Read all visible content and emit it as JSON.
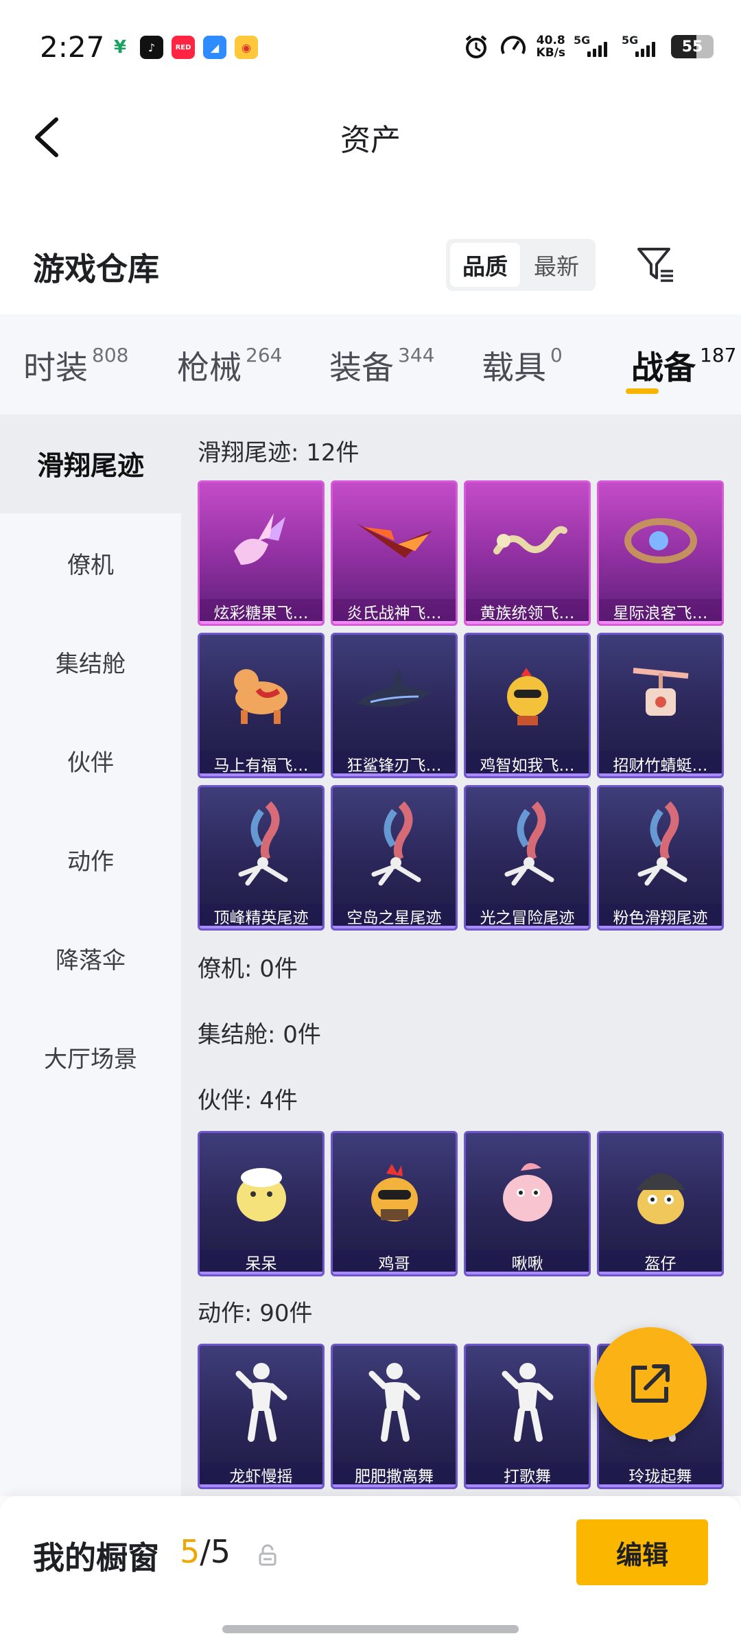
{
  "status": {
    "time": "2:27",
    "speed_value": "40.8",
    "speed_unit": "KB/s",
    "signal1": "5G",
    "signal2": "5G",
    "battery": "55"
  },
  "header": {
    "title": "资产"
  },
  "warehouse": {
    "title": "游戏仓库",
    "sort_options": [
      "品质",
      "最新"
    ],
    "active_sort": "品质"
  },
  "tabs": [
    {
      "label": "时装",
      "count": "808"
    },
    {
      "label": "枪械",
      "count": "264"
    },
    {
      "label": "装备",
      "count": "344"
    },
    {
      "label": "载具",
      "count": "0"
    },
    {
      "label": "战备",
      "count": "187"
    }
  ],
  "active_tab": "战备",
  "sidebar": {
    "items": [
      "滑翔尾迹",
      "僚机",
      "集结舱",
      "伙伴",
      "动作",
      "降落伞",
      "大厅场景"
    ],
    "active": "滑翔尾迹"
  },
  "groups": {
    "glide": {
      "title": "滑翔尾迹: 12件",
      "items": [
        {
          "name": "炫彩糖果飞…",
          "rarity": "epic",
          "art": "candy-wing-icon"
        },
        {
          "name": "炎氏战神飞…",
          "rarity": "epic",
          "art": "flame-wing-icon"
        },
        {
          "name": "黄族统领飞…",
          "rarity": "epic",
          "art": "dragon-icon"
        },
        {
          "name": "星际浪客飞…",
          "rarity": "epic",
          "art": "star-ring-icon"
        },
        {
          "name": "马上有福飞…",
          "rarity": "rare",
          "art": "horse-icon"
        },
        {
          "name": "狂鲨锋刃飞…",
          "rarity": "rare",
          "art": "shark-icon"
        },
        {
          "name": "鸡智如我飞…",
          "rarity": "rare",
          "art": "chicken-icon"
        },
        {
          "name": "招财竹蜻蜓…",
          "rarity": "rare",
          "art": "bamboo-copter-icon"
        },
        {
          "name": "顶峰精英尾迹",
          "rarity": "rare",
          "art": "smoke-trail-icon"
        },
        {
          "name": "空岛之星尾迹",
          "rarity": "rare",
          "art": "smoke-trail-icon"
        },
        {
          "name": "光之冒险尾迹",
          "rarity": "rare",
          "art": "smoke-trail-icon"
        },
        {
          "name": "粉色滑翔尾迹",
          "rarity": "rare",
          "art": "smoke-trail-icon"
        }
      ]
    },
    "drone": {
      "title": "僚机: 0件"
    },
    "pod": {
      "title": "集结舱: 0件"
    },
    "partner": {
      "title": "伙伴: 4件",
      "items": [
        {
          "name": "呆呆",
          "rarity": "rare",
          "art": "chick-icon"
        },
        {
          "name": "鸡哥",
          "rarity": "rare",
          "art": "rooster-icon"
        },
        {
          "name": "啾啾",
          "rarity": "rare",
          "art": "pink-bird-icon"
        },
        {
          "name": "盔仔",
          "rarity": "rare",
          "art": "helmet-chick-icon"
        }
      ]
    },
    "emote": {
      "title": "动作: 90件",
      "items": [
        {
          "name": "龙虾慢摇",
          "rarity": "rare",
          "art": "dance-icon"
        },
        {
          "name": "肥肥撒离舞",
          "rarity": "rare",
          "art": "dance-icon"
        },
        {
          "name": "打歌舞",
          "rarity": "rare",
          "art": "dance-icon"
        },
        {
          "name": "玲珑起舞",
          "rarity": "rare",
          "art": "dance-icon"
        }
      ]
    }
  },
  "bottom": {
    "label": "我的橱窗",
    "current": "5",
    "total": "/5",
    "edit_label": "编辑"
  },
  "colors": {
    "accent": "#fbb700",
    "epic_card": "#c44cc9",
    "rare_card": "#2a2658"
  }
}
